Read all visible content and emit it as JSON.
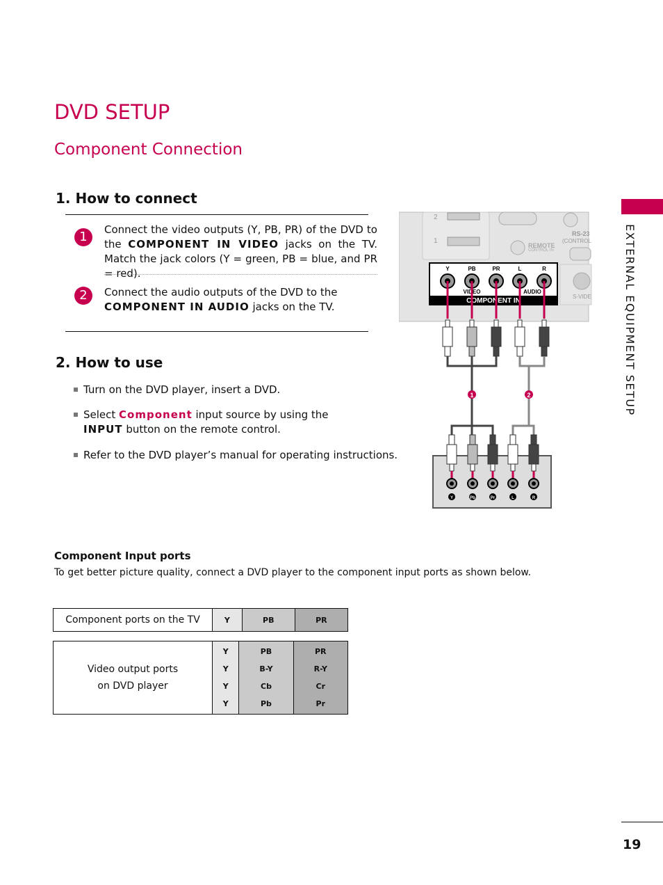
{
  "title": "DVD SETUP",
  "subtitle": "Component Connection",
  "section1": {
    "heading": "1. How to connect",
    "steps": [
      {
        "number": "1",
        "text_a": "Connect the video outputs (Y, PB, PR)  of the DVD to the ",
        "keyword": "COMPONENT IN VIDEO",
        "text_b": " jacks on the TV.  Match the jack colors (Y = green, PB = blue, and PR = red)."
      },
      {
        "number": "2",
        "text_a": "Connect the audio outputs of the DVD to the ",
        "keyword": "COMPONENT IN AUDIO",
        "text_b": " jacks on the TV."
      }
    ]
  },
  "section2": {
    "heading": "2. How to use",
    "bullets": [
      {
        "text_a": "Turn on the DVD player, insert a DVD."
      },
      {
        "text_a": "Select ",
        "keyword": "Component",
        "text_b": " input source by using the ",
        "keyword2": "INPUT",
        "text_c": " button on the remote control."
      },
      {
        "text_a": "Refer to the DVD player’s manual for operating instructions."
      }
    ]
  },
  "ports": {
    "heading": "Component Input ports",
    "description": "To get better picture quality, connect a DVD player to the component input ports as shown below.",
    "tv_row": {
      "label": "Component ports on the TV",
      "cols": [
        "Y",
        "PB",
        "PR"
      ]
    },
    "dvd_row": {
      "label_line1": "Video output ports",
      "label_line2": "on DVD player",
      "col_y": [
        "Y",
        "Y",
        "Y",
        "Y"
      ],
      "col_pb": [
        "PB",
        "B-Y",
        "Cb",
        "Pb"
      ],
      "col_pr": [
        "PR",
        "R-Y",
        "Cr",
        "Pr"
      ]
    }
  },
  "diagram": {
    "hdmi_labels": [
      "2",
      "1"
    ],
    "remote_label": "REMOTE",
    "remote_sub": "CONTROL IN",
    "rs232_label": "RS-23",
    "rs232_sub": "(CONTROL",
    "svideo_label": "S-VIDE",
    "jack_labels": [
      "Y",
      "PB",
      "PR",
      "L",
      "R"
    ],
    "video_label": "VIDEO",
    "audio_label": "AUDIO",
    "component_label": "COMPONENT IN",
    "cable_numbers": [
      "1",
      "2"
    ],
    "dvd_jack_labels": [
      "Y",
      "Pb",
      "Pr",
      "L",
      "R"
    ]
  },
  "side_tab": "EXTERNAL EQUIPMENT SETUP",
  "page_number": "19",
  "colors": {
    "accent": "#c6004f"
  }
}
